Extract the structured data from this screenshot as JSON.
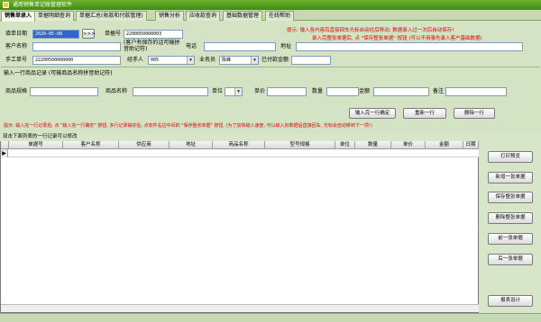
{
  "window": {
    "title": "通用销售单记账管理软件"
  },
  "tabs": [
    "销售单录入",
    "单据明细查询",
    "单据汇总(收款和付款管理)",
    "销售分析",
    "应收款查询",
    "基础数据管理",
    "在线帮助"
  ],
  "header": {
    "date_label": "填单日期",
    "date_value": "2020-05-08",
    "nav_btn": ">>>",
    "order_no_label": "单据号",
    "order_no_value": "2200050000003",
    "hint1": "提示: 输入各内容后直接回车光标自动往后移动; 数据录入过一次后自动保存!",
    "hint2": "录入完整张单据后, 点 \"保存整张单据\" 按钮 (可以不用事先录入客户基础数据)",
    "customer_label": "客户名称",
    "customer_value": "",
    "customer_hint": "(客户有保存的话可输拼音助记符)",
    "phone_label": "电话",
    "phone_value": "",
    "address_label": "地址",
    "address_value": "",
    "manual_no_label": "手工单号",
    "manual_no_value": "22200500000000",
    "handler_label": "经手人",
    "handler_value": "005",
    "salesman_label": "业务员",
    "salesman_value": "陈峰",
    "paid_label": "已付款金额",
    "paid_value": ""
  },
  "entry": {
    "section_title": "输入一行商品记录 (可输商品名称拼音助记符)",
    "spec_label": "商品规格",
    "name_label": "商品名称",
    "unit_label": "单位",
    "price_label": "单价",
    "qty_label": "数量",
    "amount_label": "金额",
    "remark_label": "备注",
    "btn_confirm": "输入完一行确定",
    "btn_clear": "重新一行",
    "btn_delete": "删除一行",
    "hint": "提示: 输入完一行记录后, 点 \"输入完一行确定\" 按钮, 多行记录输好后, 点软件右边中间的 \"保存整张单据\" 按钮, (为了加快输入速度, 可以输入好数据后直接回车, 光标会自动移到下一项!)"
  },
  "grid": {
    "caption": "双击下面列表的一行记录可以修改",
    "columns": [
      "单据号",
      "客户名称",
      "供应商",
      "地址",
      "商品名称",
      "型号规格",
      "单位",
      "数量",
      "单价",
      "金额",
      "日期"
    ]
  },
  "actions": [
    "打印预览",
    "新增一张单据",
    "保存整张单据",
    "删除整张单据",
    "前一张单据",
    "后一张单据",
    "报表设计"
  ],
  "status": {
    "left": "",
    "right": ""
  }
}
